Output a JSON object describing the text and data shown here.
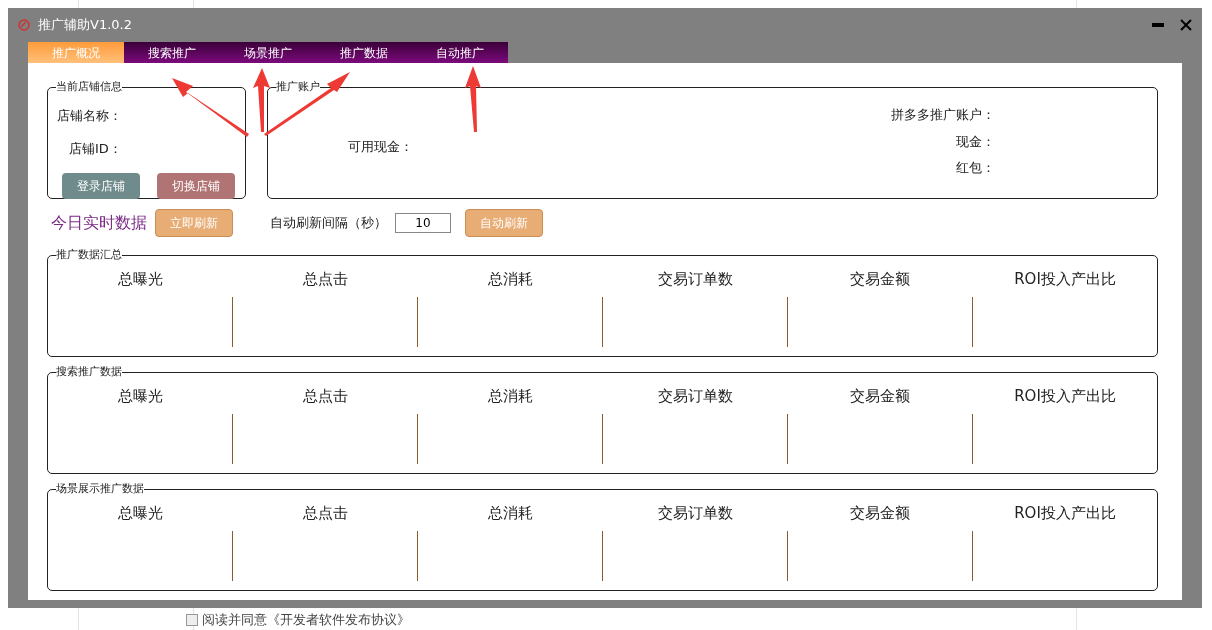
{
  "window": {
    "title": "推广辅助V1.0.2"
  },
  "tabs": [
    {
      "label": "推广概况",
      "selected": true
    },
    {
      "label": "搜索推广",
      "selected": false
    },
    {
      "label": "场景推广",
      "selected": false
    },
    {
      "label": "推广数据",
      "selected": false
    },
    {
      "label": "自动推广",
      "selected": false
    }
  ],
  "store_info": {
    "title": "当前店铺信息",
    "fields": [
      "店铺名称：",
      "店铺ID："
    ],
    "buttons": [
      {
        "label": "登录店铺",
        "color": "#6f8b8b"
      },
      {
        "label": "切换店铺",
        "color": "#b07474"
      }
    ]
  },
  "account": {
    "title": "推广账户",
    "left_fields": [
      "可用现金："
    ],
    "right_fields": [
      "拼多多推广账户：",
      "现金：",
      "红包："
    ]
  },
  "realtime": {
    "title": "今日实时数据",
    "refresh_button": "立即刷新",
    "interval_label": "自动刷新间隔（秒）",
    "interval_value": "10",
    "auto_button": "自动刷新"
  },
  "sections": [
    {
      "title": "推广数据汇总",
      "metrics": [
        "总曝光",
        "总点击",
        "总消耗",
        "交易订单数",
        "交易金额",
        "ROI投入产出比"
      ]
    },
    {
      "title": "搜索推广数据",
      "metrics": [
        "总曝光",
        "总点击",
        "总消耗",
        "交易订单数",
        "交易金额",
        "ROI投入产出比"
      ]
    },
    {
      "title": "场景展示推广数据",
      "metrics": [
        "总曝光",
        "总点击",
        "总消耗",
        "交易订单数",
        "交易金额",
        "ROI投入产出比"
      ]
    }
  ],
  "background_text": "阅读并同意《开发者软件发布协议》"
}
